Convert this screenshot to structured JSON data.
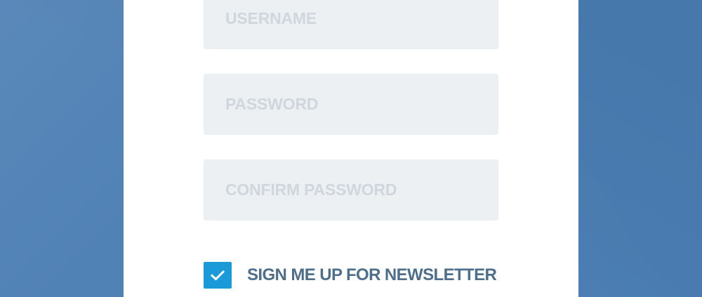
{
  "form": {
    "fields": {
      "username": {
        "placeholder": "USERNAME",
        "value": ""
      },
      "password": {
        "placeholder": "PASSWORD",
        "value": ""
      },
      "confirm_password": {
        "placeholder": "CONFIRM PASSWORD",
        "value": ""
      }
    },
    "newsletter": {
      "label": "SIGN ME UP FOR NEWSLETTER",
      "checked": true,
      "icon": "check-icon"
    }
  },
  "colors": {
    "background": "#4a7db3",
    "panel": "#ffffff",
    "field_bg": "#edf0f3",
    "placeholder": "#cfd6de",
    "checkbox": "#1a9ad8",
    "label": "#4d6f8c"
  }
}
